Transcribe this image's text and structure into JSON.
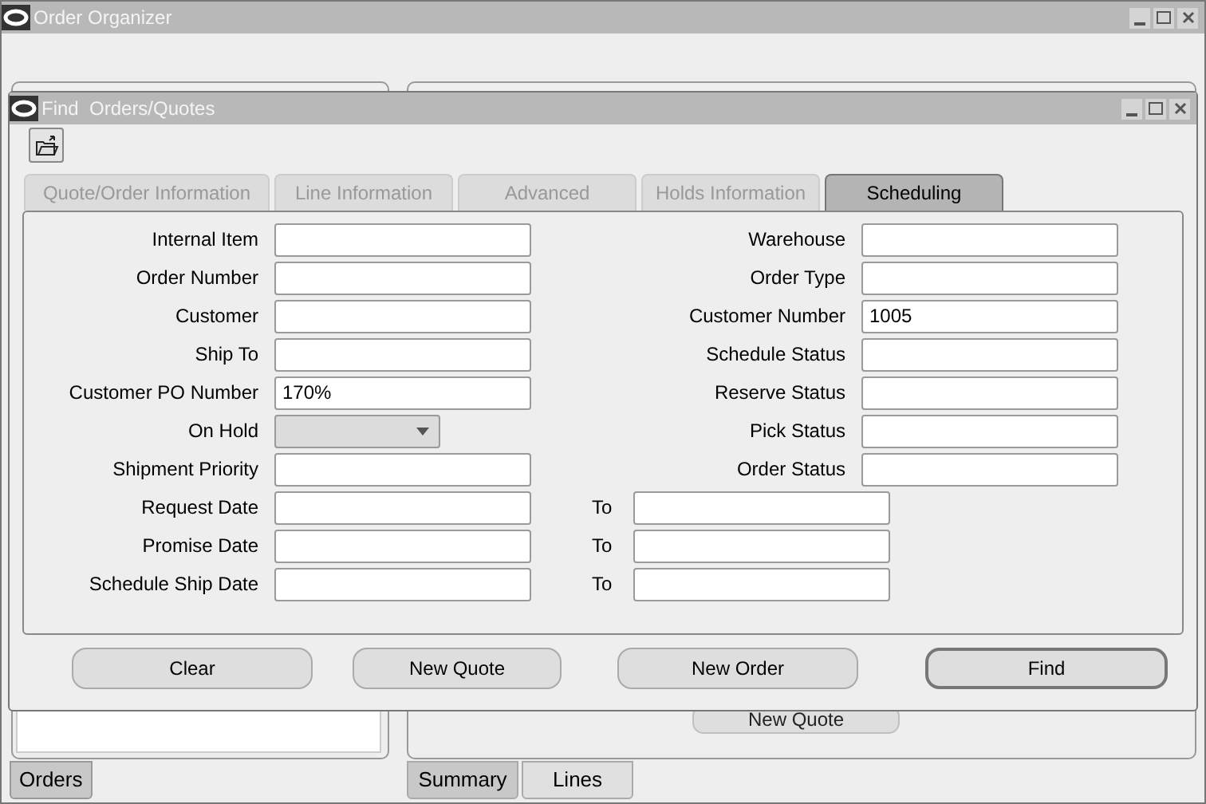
{
  "window": {
    "title": "Order Organizer"
  },
  "background_panels": {
    "action_button": "New Quote",
    "left_tabs": [
      {
        "label": "Orders",
        "selected": true
      }
    ],
    "right_tabs": [
      {
        "label": "Summary",
        "selected": true
      },
      {
        "label": "Lines",
        "selected": false
      }
    ]
  },
  "dialog": {
    "title": "Find  Orders/Quotes",
    "tabs": [
      {
        "label": "Quote/Order Information",
        "selected": false
      },
      {
        "label": "Line Information",
        "selected": false
      },
      {
        "label": "Advanced",
        "selected": false
      },
      {
        "label": "Holds Information",
        "selected": false
      },
      {
        "label": "Scheduling",
        "selected": true
      }
    ],
    "left_fields": [
      {
        "label": "Internal Item",
        "kind": "text"
      },
      {
        "label": "Order Number",
        "kind": "text"
      },
      {
        "label": "Customer",
        "kind": "text"
      },
      {
        "label": "Ship To",
        "kind": "text"
      },
      {
        "label": "Customer PO Number",
        "kind": "text",
        "value": "170%"
      },
      {
        "label": "On Hold",
        "kind": "dropdown"
      },
      {
        "label": "Shipment Priority",
        "kind": "text"
      },
      {
        "label": "Request Date",
        "kind": "range",
        "to_label": "To"
      },
      {
        "label": "Promise Date",
        "kind": "range",
        "to_label": "To"
      },
      {
        "label": "Schedule Ship Date",
        "kind": "range",
        "to_label": "To"
      }
    ],
    "right_fields": [
      {
        "label": "Warehouse"
      },
      {
        "label": "Order Type"
      },
      {
        "label": "Customer Number",
        "value": "1005"
      },
      {
        "label": "Schedule Status"
      },
      {
        "label": "Reserve Status"
      },
      {
        "label": "Pick Status"
      },
      {
        "label": "Order Status"
      }
    ],
    "buttons": [
      {
        "label": "Clear",
        "default": false
      },
      {
        "label": "New Quote",
        "default": false
      },
      {
        "label": "New Order",
        "default": false
      },
      {
        "label": "Find",
        "default": true
      }
    ]
  }
}
